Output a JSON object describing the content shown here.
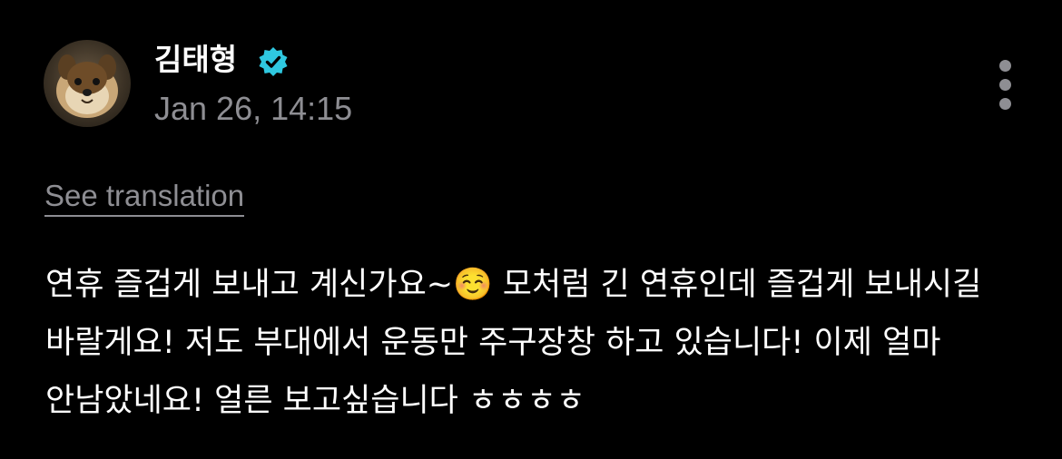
{
  "post": {
    "author": {
      "name": "김태형",
      "verified_icon": "verified-badge-icon",
      "verified_color": "#2fc8e0",
      "avatar_icon": "dog-avatar"
    },
    "timestamp": "Jan 26, 14:15",
    "more_icon": "vertical-ellipsis-icon",
    "translate_label": "See translation",
    "body": "연휴 즐겁게 보내고 계신가요~☺️ 모처럼 긴 연휴인데 즐겁게 보내시길 바랄게요! 저도 부대에서 운동만 주구장창 하고 있습니다! 이제 얼마 안남았네요! 얼른 보고싶습니다 ㅎㅎㅎㅎ"
  },
  "colors": {
    "background": "#000000",
    "text": "#ffffff",
    "muted": "#8e8e93",
    "accent": "#2fc8e0"
  }
}
